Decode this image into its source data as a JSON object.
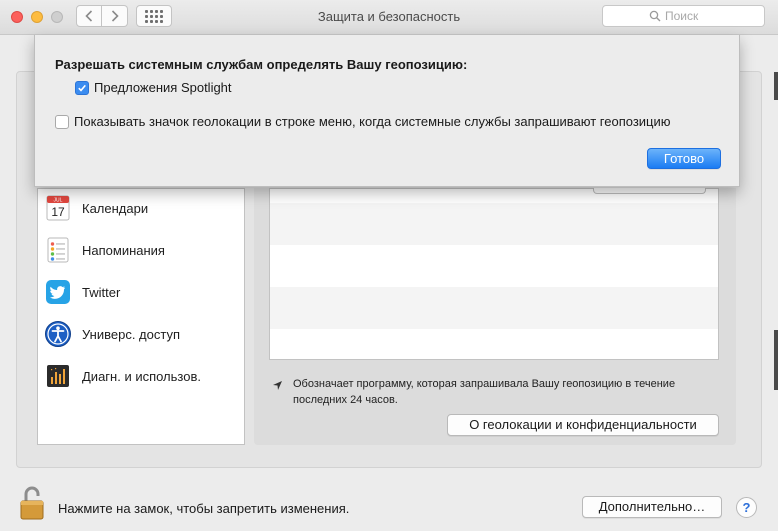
{
  "window": {
    "title": "Защита и безопасность",
    "search_placeholder": "Поиск"
  },
  "toolbar": {
    "back_icon": "chevron-left-icon",
    "forward_icon": "chevron-right-icon",
    "grid_icon": "show-all-grid-icon"
  },
  "sheet": {
    "heading": "Разрешать системным службам определять Вашу геопозицию:",
    "options": [
      {
        "label": "Предложения Spotlight",
        "checked": true
      },
      {
        "label": "Показывать значок геолокации в строке меню, когда системные службы запрашивают геопозицию",
        "checked": false
      }
    ],
    "done_label": "Готово"
  },
  "apps": [
    {
      "label": "Календари",
      "icon": "calendar-icon"
    },
    {
      "label": "Напоминания",
      "icon": "reminders-icon"
    },
    {
      "label": "Twitter",
      "icon": "twitter-icon"
    },
    {
      "label": "Универс. доступ",
      "icon": "accessibility-icon"
    },
    {
      "label": "Диагн. и использов.",
      "icon": "diagnostics-icon"
    }
  ],
  "calendar_day": "17",
  "location_note": "Обозначает программу, которая запрашивала Вашу геопозицию в течение последних 24 часов.",
  "privacy_button": "О геолокации и конфиденциальности",
  "lock_message": "Нажмите на замок, чтобы запретить изменения.",
  "advanced_button": "Дополнительно…",
  "help_label": "?",
  "colors": {
    "accent": "#1b7cf3",
    "checkbox_on": "#3b8cf0",
    "twitter": "#1da1f2"
  }
}
